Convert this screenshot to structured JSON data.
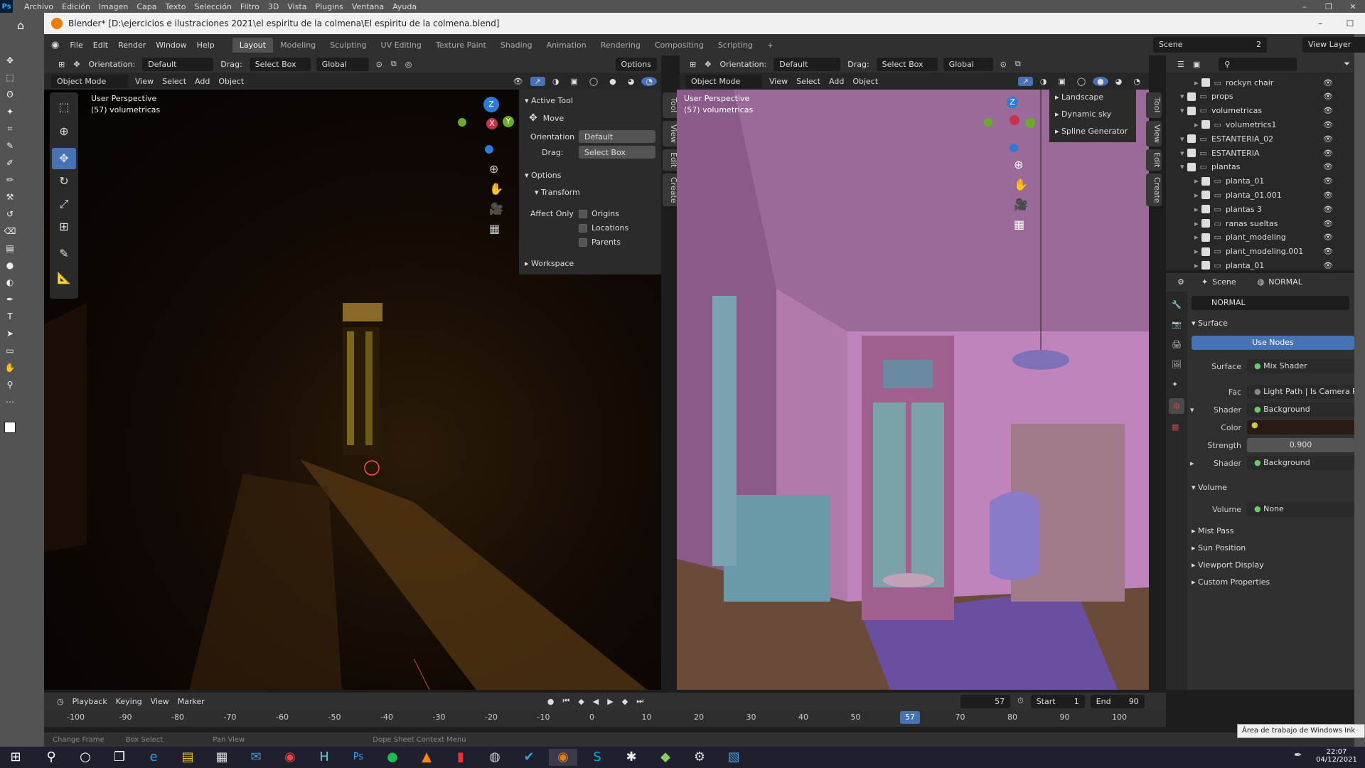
{
  "ps_menu": {
    "logo": "Ps",
    "items": [
      "Archivo",
      "Edición",
      "Imagen",
      "Capa",
      "Texto",
      "Selección",
      "Filtro",
      "3D",
      "Vista",
      "Plugins",
      "Ventana",
      "Ayuda"
    ]
  },
  "window": {
    "title": "Blender* [D:\\ejercicios e ilustraciones 2021\\el espiritu de la colmena\\El espiritu de la colmena.blend]"
  },
  "topbar": {
    "menus": [
      "File",
      "Edit",
      "Render",
      "Window",
      "Help"
    ],
    "workspaces": [
      "Layout",
      "Modeling",
      "Sculpting",
      "UV Editing",
      "Texture Paint",
      "Shading",
      "Animation",
      "Rendering",
      "Compositing",
      "Scripting"
    ],
    "active_workspace": "Layout",
    "scene": "Scene",
    "scene_users": "2",
    "view_layer": "View Layer"
  },
  "tool_header": {
    "orientation_label": "Orientation:",
    "orientation_value": "Default",
    "drag_label": "Drag:",
    "drag_value": "Select Box",
    "transform": "Global",
    "options": "Options"
  },
  "viewport_left": {
    "mode": "Object Mode",
    "menus": [
      "View",
      "Select",
      "Add",
      "Object"
    ],
    "perspective": "User Perspective",
    "collection": "(57) volumetricas"
  },
  "viewport_right": {
    "mode": "Object Mode",
    "menus": [
      "View",
      "Select",
      "Add",
      "Object"
    ],
    "perspective": "User Perspective",
    "collection": "(57) volumetricas",
    "addons": [
      "Landscape",
      "Dynamic sky",
      "Spline Generator"
    ]
  },
  "npanel": {
    "active_tool": "Active Tool",
    "tool_name": "Move",
    "orientation_label": "Orientation",
    "orientation_value": "Default",
    "drag_label": "Drag:",
    "drag_value": "Select Box",
    "options": "Options",
    "transform": "Transform",
    "affect_only": "Affect Only",
    "origins": "Origins",
    "locations": "Locations",
    "parents": "Parents",
    "workspace": "Workspace",
    "tabs": [
      "Tool",
      "View",
      "Edit",
      "Create"
    ]
  },
  "outliner": {
    "rows": [
      {
        "name": "rockyn chair",
        "indent": 1
      },
      {
        "name": "props",
        "indent": 0
      },
      {
        "name": "volumetricas",
        "indent": 0
      },
      {
        "name": "volumetrics1",
        "indent": 1
      },
      {
        "name": "ESTANTERIA_02",
        "indent": 0
      },
      {
        "name": "ESTANTERIA",
        "indent": 0
      },
      {
        "name": "plantas",
        "indent": 0
      },
      {
        "name": "planta_01",
        "indent": 1
      },
      {
        "name": "planta_01.001",
        "indent": 1
      },
      {
        "name": "plantas 3",
        "indent": 1
      },
      {
        "name": "ranas sueltas",
        "indent": 1
      },
      {
        "name": "plant_modeling",
        "indent": 1
      },
      {
        "name": "plant_modeling.001",
        "indent": 1
      },
      {
        "name": "planta_01",
        "indent": 1
      }
    ]
  },
  "properties": {
    "scene": "Scene",
    "world": "NORMAL",
    "world_field": "NORMAL",
    "surface": "Surface",
    "use_nodes": "Use Nodes",
    "surface_label": "Surface",
    "surface_value": "Mix Shader",
    "fac_label": "Fac",
    "fac_value": "Light Path | Is Camera R",
    "shader1_label": "Shader",
    "shader1_value": "Background",
    "color_label": "Color",
    "strength_label": "Strength",
    "strength_value": "0.900",
    "shader2_label": "Shader",
    "shader2_value": "Background",
    "volume": "Volume",
    "volume_label": "Volume",
    "volume_value": "None",
    "sections": [
      "Mist Pass",
      "Sun Position",
      "Viewport Display",
      "Custom Properties"
    ]
  },
  "timeline": {
    "menus": [
      "Playback",
      "Keying",
      "View",
      "Marker"
    ],
    "current_frame": "57",
    "start_label": "Start",
    "start": "1",
    "end_label": "End",
    "end": "90",
    "ticks": [
      "-100",
      "-90",
      "-80",
      "-70",
      "-60",
      "-50",
      "-40",
      "-30",
      "-20",
      "-10",
      "0",
      "10",
      "20",
      "30",
      "40",
      "50",
      "60",
      "70",
      "80",
      "90",
      "100"
    ]
  },
  "statusbar": {
    "items": [
      "Change Frame",
      "Box Select",
      "Pan View",
      "Dope Sheet Context Menu"
    ]
  },
  "taskbar": {
    "time": "22:07",
    "date": "04/12/2021",
    "tooltip": "Área de trabajo de Windows Ink"
  },
  "colors": {
    "accent": "#4772b3",
    "panel": "#303030",
    "dark": "#1d1d1d",
    "orange": "#e87d0d"
  }
}
